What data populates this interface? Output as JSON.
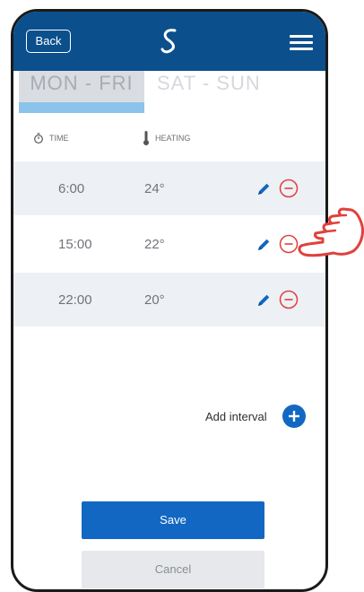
{
  "header": {
    "back_label": "Back",
    "logo": "salus-logo-icon",
    "menu": "hamburger-menu-icon"
  },
  "tabs": [
    {
      "label": "MON - FRI",
      "active": true
    },
    {
      "label": "SAT - SUN",
      "active": false
    }
  ],
  "columns": {
    "time": "TIME",
    "heating": "HEATING"
  },
  "intervals": [
    {
      "time": "6:00",
      "temp": "24°"
    },
    {
      "time": "15:00",
      "temp": "22°"
    },
    {
      "time": "22:00",
      "temp": "20°"
    }
  ],
  "actions": {
    "add_interval": "Add interval",
    "save": "Save",
    "cancel": "Cancel"
  },
  "colors": {
    "topbar": "#0b4f8c",
    "accent": "#1267c2",
    "delete": "#e0413c",
    "active_tab_indicator": "#8cc3ea"
  }
}
